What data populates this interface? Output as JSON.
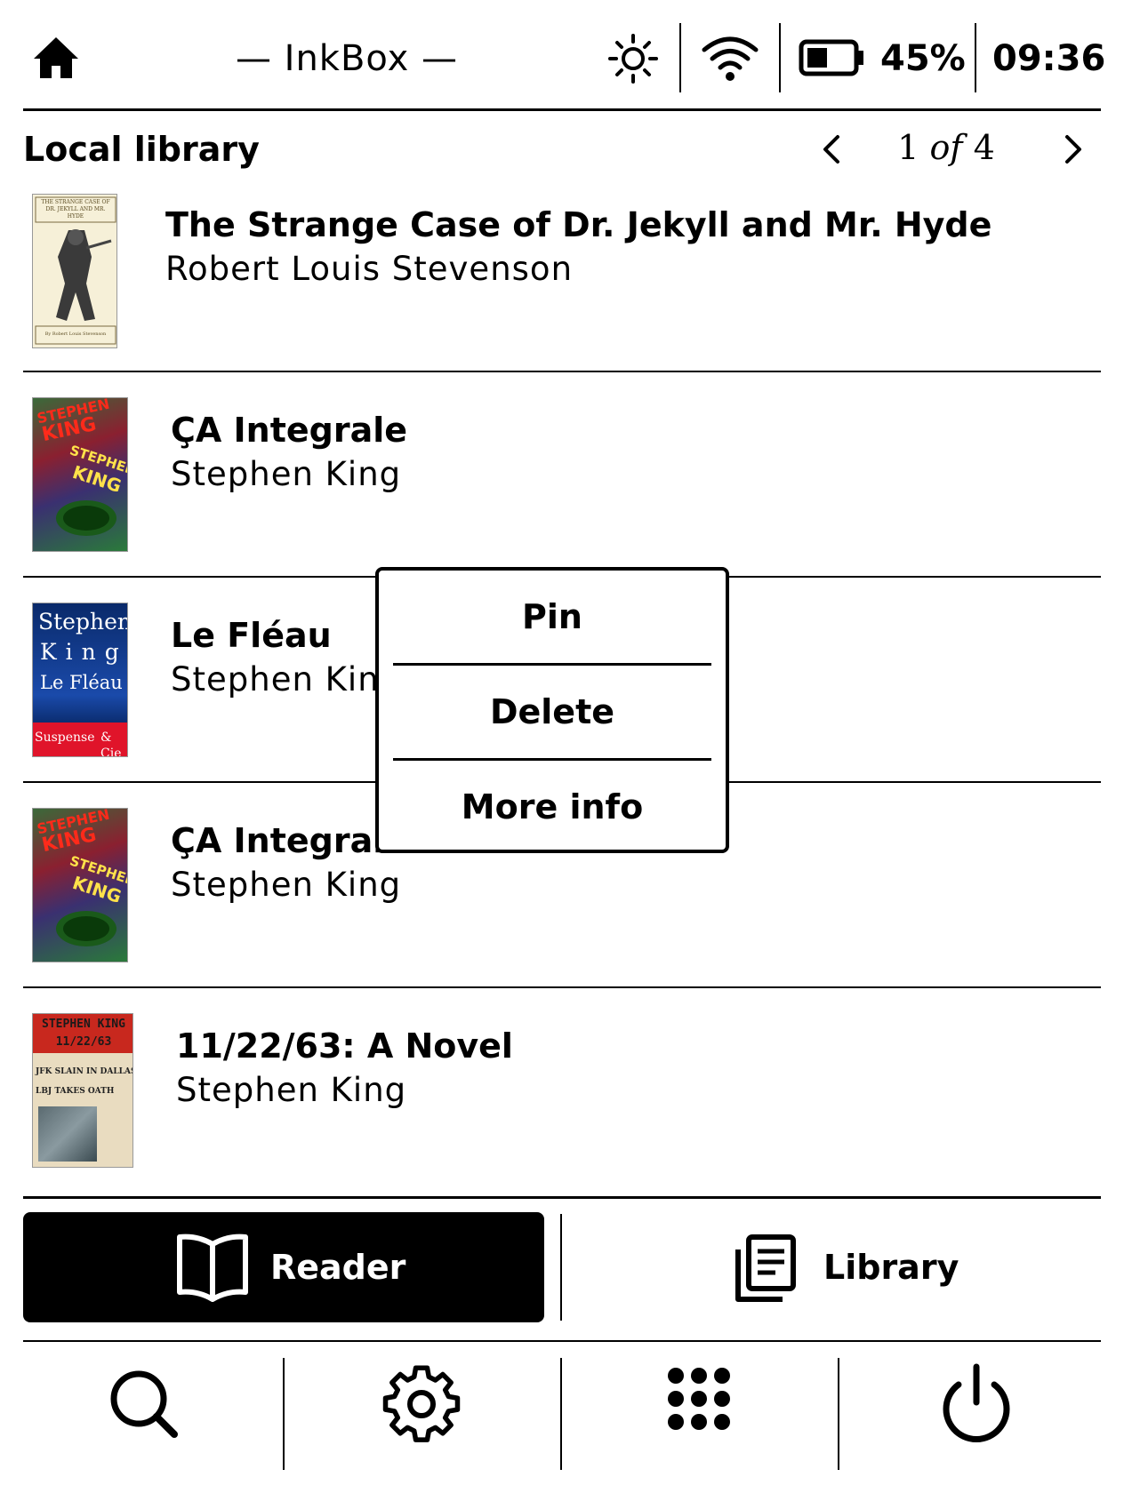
{
  "status_bar": {
    "app_title": "— InkBox —",
    "battery_percent": "45%",
    "battery_level": 0.45,
    "time": "09:36",
    "icons": [
      "home-icon",
      "brightness-icon",
      "wifi-icon",
      "battery-icon"
    ]
  },
  "library": {
    "title": "Local library",
    "pagination": {
      "current": "1",
      "of": "of",
      "total": "4"
    },
    "books": [
      {
        "title": "The Strange Case of Dr. Jekyll and Mr. Hyde",
        "author": "Robert Louis Stevenson",
        "cover": {
          "top_text": "THE STRANGE CASE OF DR. JEKYLL AND MR. HYDE",
          "bottom_text": "By Robert Louis Stevenson"
        }
      },
      {
        "title": "ÇA Integrale",
        "author": "Stephen King",
        "cover": {
          "line1": "STEPHEN",
          "line2": "KING"
        }
      },
      {
        "title": "Le Fléau",
        "author": "Stephen King",
        "cover": {
          "line1": "Stephen",
          "line2": "King",
          "line3": "Le Fléau",
          "band": "Suspense",
          "band2": "& Cie"
        }
      },
      {
        "title": "ÇA Integrale",
        "author": "Stephen King",
        "cover": {
          "line1": "STEPHEN",
          "line2": "KING"
        }
      },
      {
        "title": "11/22/63: A Novel",
        "author": "Stephen King",
        "cover": {
          "line1": "STEPHEN KING",
          "line2": "11/22/63",
          "line3": "JFK SLAIN IN DALLAS,",
          "line4": "LBJ TAKES OATH"
        }
      }
    ]
  },
  "context_menu": {
    "items": [
      "Pin",
      "Delete",
      "More info"
    ]
  },
  "bottom_tabs": {
    "reader_label": "Reader",
    "library_label": "Library"
  },
  "toolbar": {
    "icons": [
      "search-icon",
      "settings-icon",
      "apps-icon",
      "power-icon"
    ]
  },
  "colors": {
    "foreground": "#000000",
    "background": "#ffffff",
    "active_tab": "#000000"
  }
}
